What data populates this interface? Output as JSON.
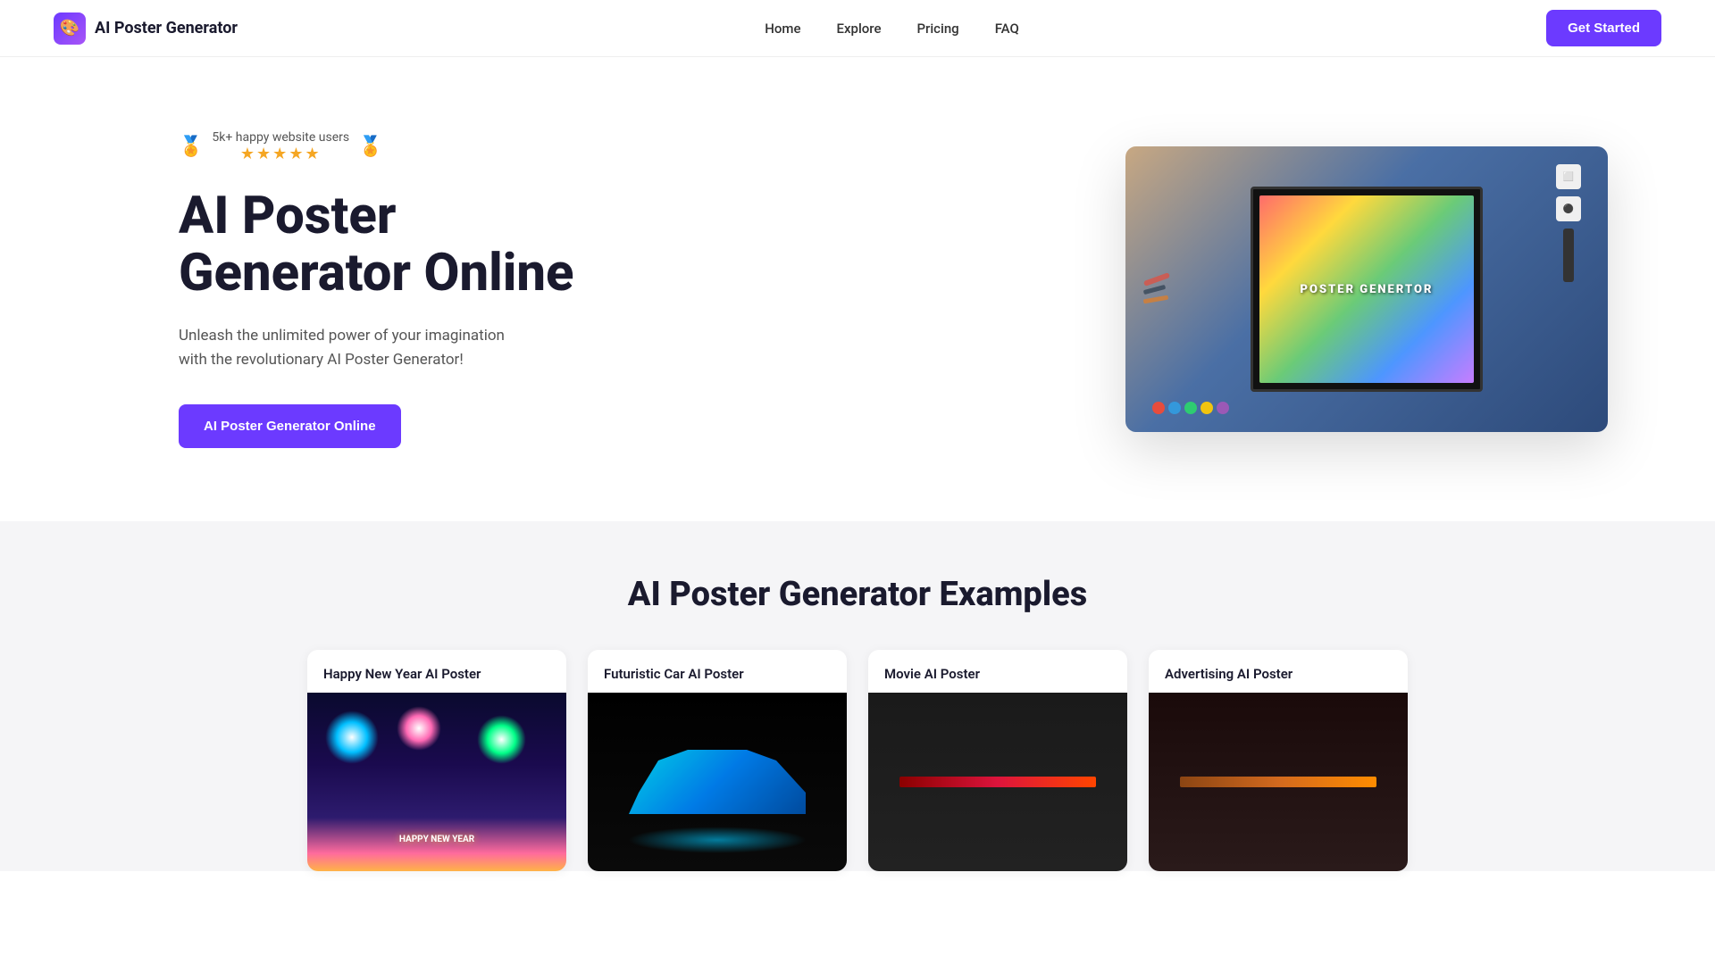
{
  "navbar": {
    "logo_icon": "🎨",
    "logo_text": "AI Poster Generator",
    "links": [
      {
        "id": "home",
        "label": "Home"
      },
      {
        "id": "explore",
        "label": "Explore"
      },
      {
        "id": "pricing",
        "label": "Pricing"
      },
      {
        "id": "faq",
        "label": "FAQ"
      }
    ],
    "cta_label": "Get Started"
  },
  "hero": {
    "badge_text": "5k+ happy website users",
    "stars": "★★★★★",
    "title": "AI Poster Generator Online",
    "subtitle": "Unleash the unlimited power of your imagination with the revolutionary AI Poster Generator!",
    "cta_label": "AI Poster Generator Online",
    "poster_label": "POSTER GENERTOR"
  },
  "examples_section": {
    "title": "AI Poster Generator Examples",
    "cards": [
      {
        "id": "happy-new-year",
        "title": "Happy New Year AI Poster",
        "type": "fireworks"
      },
      {
        "id": "futuristic-car",
        "title": "Futuristic Car AI Poster",
        "type": "car"
      },
      {
        "id": "movie",
        "title": "Movie AI Poster",
        "type": "movie"
      },
      {
        "id": "advertising",
        "title": "Advertising AI Poster",
        "type": "ad"
      }
    ]
  }
}
